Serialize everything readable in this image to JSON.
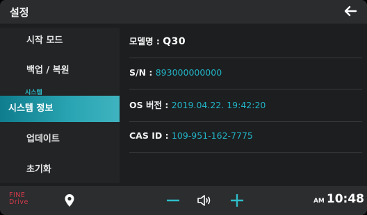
{
  "header": {
    "title": "설정",
    "back_icon": "arrow-left-icon"
  },
  "sidebar": {
    "items": [
      {
        "label": "시작 모드"
      },
      {
        "label": "백업 / 복원"
      },
      {
        "label": "시스템 정보",
        "active": true
      },
      {
        "label": "업데이트"
      },
      {
        "label": "초기화"
      }
    ],
    "section_label": "시스템"
  },
  "info": {
    "model_label": "모델명 : ",
    "model_value": "Q30",
    "serial_label": "S/N : ",
    "serial_value": "893000000000",
    "os_label": "OS 버전 : ",
    "os_value": "2019.04.22. 19:42:20",
    "cas_label": "CAS ID : ",
    "cas_value": "109-951-162-7775"
  },
  "bottom_bar": {
    "logo_line1": "FINE",
    "logo_line2": "Drive",
    "ampm": "AM",
    "time": "10:48",
    "icons": [
      "location-pin-icon",
      "volume-minus-icon",
      "speaker-icon",
      "volume-plus-icon"
    ]
  },
  "colors": {
    "accent": "#22b4c6",
    "active_gradient_start": "#0f7d8d",
    "active_gradient_end": "#3fb3bf",
    "logo": "#d23a4a",
    "background": "#1c1e20"
  }
}
